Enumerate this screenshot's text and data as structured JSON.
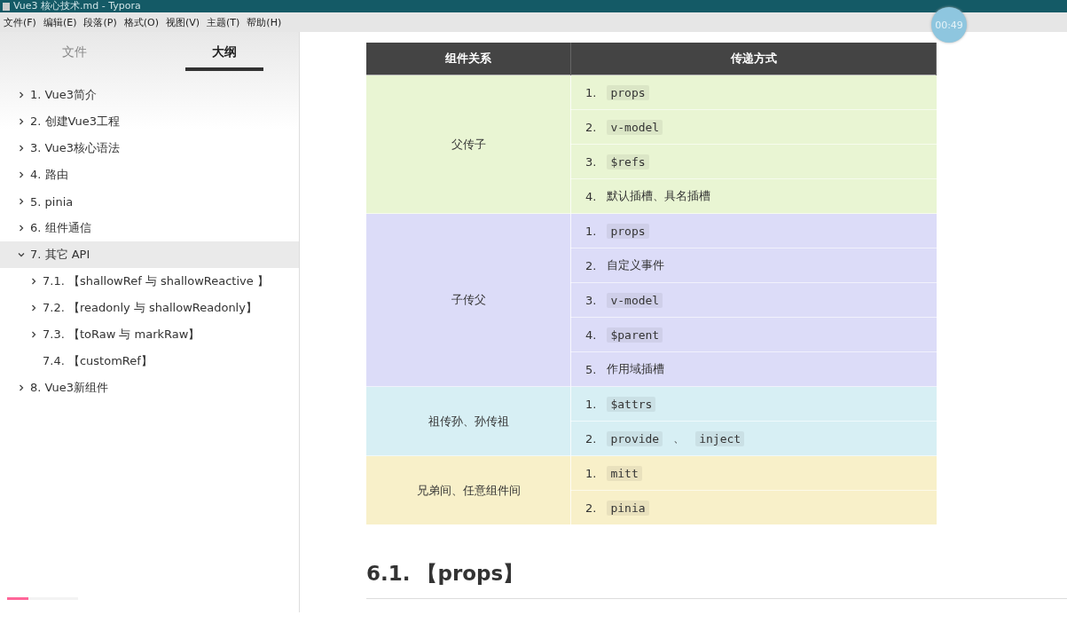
{
  "window": {
    "title": "Vue3 核心技术.md - Typora"
  },
  "menu": [
    "文件(F)",
    "编辑(E)",
    "段落(P)",
    "格式(O)",
    "视图(V)",
    "主题(T)",
    "帮助(H)"
  ],
  "timer": "00:49",
  "sidebar": {
    "tabs": [
      {
        "label": "文件",
        "selected": false
      },
      {
        "label": "大纲",
        "selected": true
      }
    ],
    "items": [
      {
        "label": "1. Vue3简介",
        "kind": "collapsed",
        "selected": false
      },
      {
        "label": "2. 创建Vue3工程",
        "kind": "collapsed",
        "selected": false
      },
      {
        "label": "3. Vue3核心语法",
        "kind": "collapsed",
        "selected": false
      },
      {
        "label": "4. 路由",
        "kind": "collapsed",
        "selected": false
      },
      {
        "label": "5. pinia",
        "kind": "collapsed",
        "selected": false
      },
      {
        "label": "6. 组件通信",
        "kind": "collapsed",
        "selected": false
      },
      {
        "label": "7. 其它 API",
        "kind": "expanded",
        "selected": true,
        "children": [
          {
            "label": "7.1. 【shallowRef 与 shallowReactive 】",
            "kind": "collapsed",
            "selected": false
          },
          {
            "label": "7.2. 【readonly 与 shallowReadonly】",
            "kind": "collapsed",
            "selected": false
          },
          {
            "label": "7.3. 【toRaw 与 markRaw】",
            "kind": "collapsed",
            "selected": false
          },
          {
            "label": "7.4. 【customRef】",
            "kind": "leaf",
            "selected": false
          }
        ]
      },
      {
        "label": "8. Vue3新组件",
        "kind": "collapsed",
        "selected": false
      }
    ],
    "progress": {
      "level": 0.3
    }
  },
  "table": {
    "columns": [
      "组件关系",
      "传递方式"
    ],
    "groups": [
      {
        "relation": "父传子",
        "color": "#e9f5d3",
        "items": [
          {
            "number": "1.",
            "parts": [
              {
                "kind": "code",
                "text": "props"
              }
            ]
          },
          {
            "number": "2.",
            "parts": [
              {
                "kind": "code",
                "text": "v-model"
              }
            ]
          },
          {
            "number": "3.",
            "parts": [
              {
                "kind": "code",
                "text": "$refs"
              }
            ]
          },
          {
            "number": "4.",
            "parts": [
              {
                "kind": "text",
                "text": "默认插槽、具名插槽"
              }
            ]
          }
        ]
      },
      {
        "relation": "子传父",
        "color": "#dcdcf8",
        "items": [
          {
            "number": "1.",
            "parts": [
              {
                "kind": "code",
                "text": "props"
              }
            ]
          },
          {
            "number": "2.",
            "parts": [
              {
                "kind": "text",
                "text": "自定义事件"
              }
            ]
          },
          {
            "number": "3.",
            "parts": [
              {
                "kind": "code",
                "text": "v-model"
              }
            ]
          },
          {
            "number": "4.",
            "parts": [
              {
                "kind": "code",
                "text": "$parent"
              }
            ]
          },
          {
            "number": "5.",
            "parts": [
              {
                "kind": "text",
                "text": "作用域插槽"
              }
            ]
          }
        ]
      },
      {
        "relation": "祖传孙、孙传祖",
        "color": "#d7eff4",
        "items": [
          {
            "number": "1.",
            "parts": [
              {
                "kind": "code",
                "text": "$attrs"
              }
            ]
          },
          {
            "number": "2.",
            "parts": [
              {
                "kind": "code",
                "text": "provide"
              },
              {
                "kind": "text",
                "text": "、"
              },
              {
                "kind": "code",
                "text": "inject"
              }
            ]
          }
        ]
      },
      {
        "relation": "兄弟间、任意组件间",
        "color": "#f8f0c9",
        "items": [
          {
            "number": "1.",
            "parts": [
              {
                "kind": "code",
                "text": "mitt"
              }
            ]
          },
          {
            "number": "2.",
            "parts": [
              {
                "kind": "code",
                "text": "pinia"
              }
            ]
          }
        ]
      }
    ]
  },
  "heading": "6.1. 【props】"
}
